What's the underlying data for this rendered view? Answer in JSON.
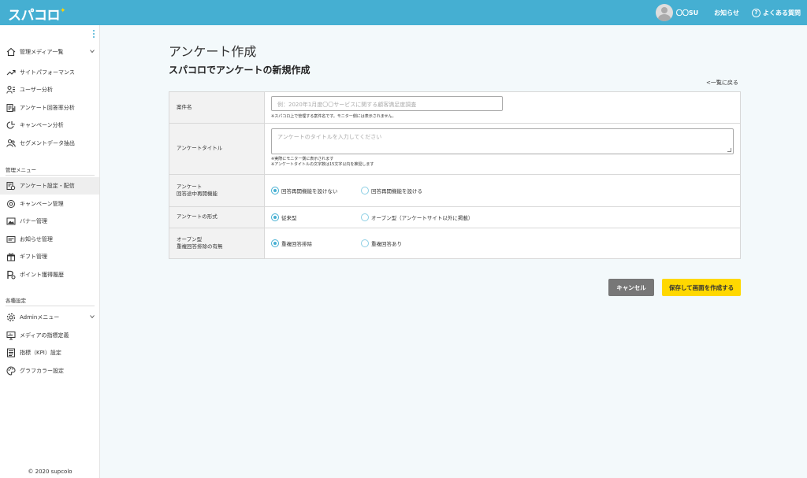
{
  "header": {
    "logo": "スパコロ",
    "user_name": "〇〇SU",
    "notice": "お知らせ",
    "faq": "よくある質問",
    "help_glyph": "?"
  },
  "sidebar": {
    "top_items": [
      {
        "label": "管理メディア一覧",
        "icon": "home-icon"
      },
      {
        "label": "サイトパフォーマンス",
        "icon": "trend-icon"
      },
      {
        "label": "ユーザー分析",
        "icon": "user-list-icon"
      },
      {
        "label": "アンケート回答率分析",
        "icon": "survey-rate-icon"
      },
      {
        "label": "キャンペーン分析",
        "icon": "campaign-analysis-icon"
      },
      {
        "label": "セグメントデータ抽出",
        "icon": "segment-icon"
      }
    ],
    "section_manage": "管理メニュー",
    "manage_items": [
      {
        "label": "アンケート設定・配信",
        "icon": "survey-settings-icon"
      },
      {
        "label": "キャンペーン管理",
        "icon": "campaign-icon"
      },
      {
        "label": "バナー管理",
        "icon": "banner-icon"
      },
      {
        "label": "お知らせ管理",
        "icon": "notice-icon"
      },
      {
        "label": "ギフト管理",
        "icon": "gift-icon"
      },
      {
        "label": "ポイント獲得履歴",
        "icon": "points-icon"
      }
    ],
    "section_settings": "各種設定",
    "settings_items": [
      {
        "label": "Adminメニュー",
        "icon": "gear-icon"
      },
      {
        "label": "メディアの指標定義",
        "icon": "metrics-icon"
      },
      {
        "label": "指標（KPI）設定",
        "icon": "kpi-icon"
      },
      {
        "label": "グラフカラー設定",
        "icon": "palette-icon"
      }
    ],
    "copyright": "© 2020 supcolo"
  },
  "main": {
    "title": "アンケート作成",
    "subtitle": "スパコロでアンケートの新規作成",
    "back_link": "一覧に戻る"
  },
  "form": {
    "case_name": {
      "label": "案件名",
      "placeholder": "例：2020年1月度〇〇サービスに関する顧客満足度調査",
      "note": "※スパコロ上で管理する案件名です。モニター側には表示されません。"
    },
    "survey_title": {
      "label": "アンケートタイトル",
      "placeholder": "アンケートのタイトルを入力してください",
      "note1": "※実際にモニター側に表示されます",
      "note2": "※アンケートタイトルの文字数は15文字以内を推奨します"
    },
    "resume": {
      "label1": "アンケート",
      "label2": "回答途中再開機能",
      "options": [
        "回答再開機能を設けない",
        "回答再開機能を設ける"
      ],
      "selected": 0
    },
    "format": {
      "label": "アンケートの形式",
      "options": [
        "従来型",
        "オープン型（アンケートサイト以外に掲載）"
      ],
      "selected": 0
    },
    "dedupe": {
      "label1": "オープン型",
      "label2": "重複回答排除の有無",
      "options": [
        "重複回答排除",
        "重複回答あり"
      ],
      "selected": 0
    }
  },
  "actions": {
    "cancel": "キャンセル",
    "save": "保存して画面を作成する"
  },
  "colors": {
    "header": "#45afd2",
    "accent_yellow": "#ffd800",
    "cancel_gray": "#777777"
  }
}
